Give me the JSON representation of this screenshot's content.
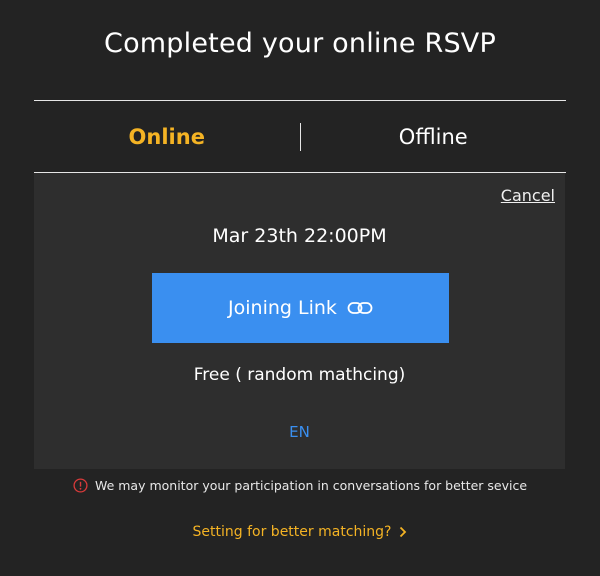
{
  "header": {
    "title": "Completed your online RSVP"
  },
  "tabs": [
    {
      "label": "Online",
      "active": true
    },
    {
      "label": "Offline",
      "active": false
    }
  ],
  "panel": {
    "cancel_label": "Cancel",
    "datetime": "Mar 23th 22:00PM",
    "join_button_label": "Joining Link",
    "join_button_icon": "link-icon",
    "price_text": "Free ( random mathcing)",
    "language": "EN"
  },
  "notice": {
    "icon": "alert-circle-icon",
    "text": "We may monitor your participation in conversations for better sevice"
  },
  "settings_link": {
    "label": "Setting for better matching?",
    "icon": "chevron-right-icon"
  },
  "colors": {
    "background": "#232323",
    "panel": "#2e2e2e",
    "accent_yellow": "#f4b324",
    "accent_blue": "#3a8ff0",
    "alert_red": "#d93a3a"
  }
}
